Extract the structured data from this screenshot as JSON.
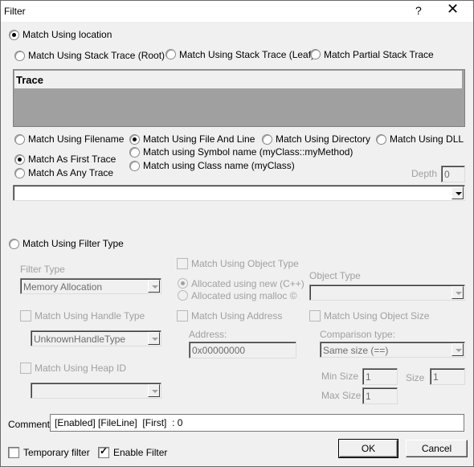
{
  "window": {
    "title": "Filter",
    "help_label": "?",
    "close_label": "✕"
  },
  "location": {
    "main_radio_label": "Match Using location",
    "stack_options": [
      {
        "label": "Match Using Stack Trace (Root)",
        "selected": false
      },
      {
        "label": "Match Using Stack Trace (Leaf)",
        "selected": false
      },
      {
        "label": "Match Partial Stack Trace",
        "selected": false
      }
    ],
    "trace_table": {
      "header": "Trace",
      "rows": []
    },
    "match_options": [
      {
        "label": "Match Using Filename",
        "selected": false
      },
      {
        "label": "Match Using File And Line",
        "selected": true
      },
      {
        "label": "Match Using Directory",
        "selected": false
      },
      {
        "label": "Match Using DLL",
        "selected": false
      },
      {
        "label": "Match using Symbol name (myClass::myMethod)",
        "selected": false
      },
      {
        "label": "Match using Class name (myClass)",
        "selected": false
      }
    ],
    "trace_options": [
      {
        "label": "Match As First Trace",
        "selected": true
      },
      {
        "label": "Match As Any Trace",
        "selected": false
      }
    ],
    "depth_label": "Depth",
    "depth_value": "0",
    "location_combo_value": ""
  },
  "filter_type": {
    "main_radio_label": "Match Using Filter Type",
    "filter_type_label": "Filter Type",
    "filter_type_value": "Memory Allocation",
    "object_type_check_label": "Match Using Object Type",
    "alloc_options": [
      {
        "label": "Allocated using new (C++)",
        "selected": true
      },
      {
        "label": "Allocated using malloc ©",
        "selected": false
      }
    ],
    "object_type_label": "Object Type",
    "object_type_value": "",
    "handle_type_check_label": "Match Using Handle Type",
    "handle_type_value": "UnknownHandleType",
    "address_check_label": "Match Using Address",
    "address_label": "Address:",
    "address_value": "0x00000000",
    "object_size_check_label": "Match Using Object Size",
    "comparison_label": "Comparison type:",
    "comparison_value": "Same size (==)",
    "heap_id_check_label": "Match Using Heap ID",
    "heap_id_value": "",
    "min_size_label": "Min Size",
    "min_size_value": "1",
    "max_size_label": "Max Size",
    "max_size_value": "1",
    "size_label": "Size",
    "size_value": "1"
  },
  "footer": {
    "comment_label": "Comment",
    "comment_value": "[Enabled] [FileLine]  [First]  : 0",
    "temporary_label": "Temporary filter",
    "temporary_checked": false,
    "enable_label": "Enable Filter",
    "enable_checked": true,
    "ok_label": "OK",
    "cancel_label": "Cancel"
  }
}
